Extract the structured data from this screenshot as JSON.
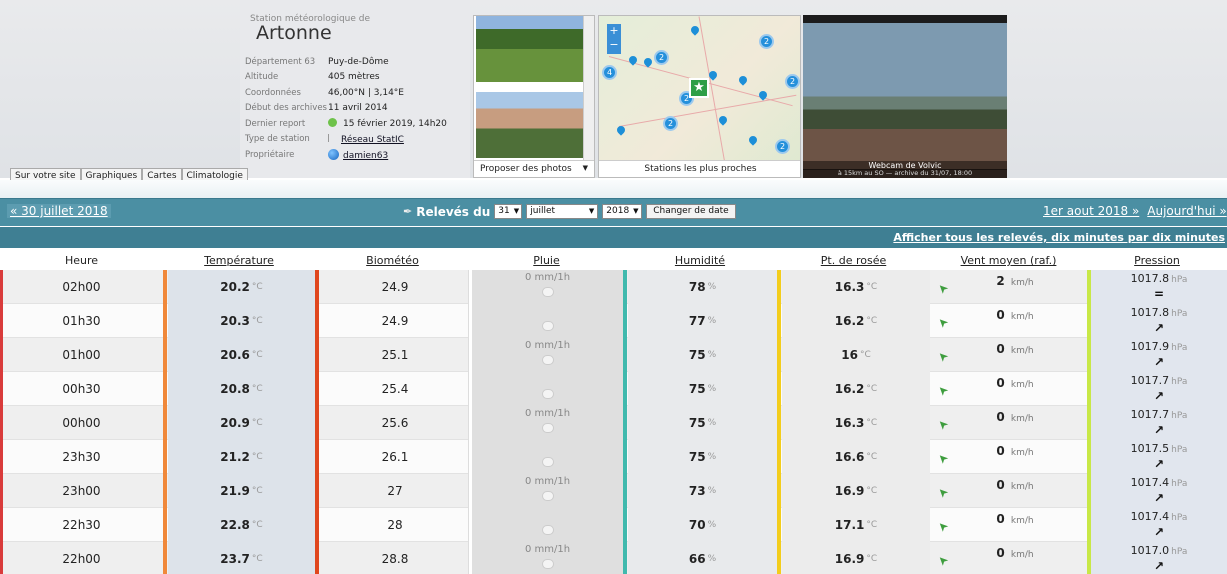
{
  "header": {
    "station_subtitle": "Station météorologique de",
    "station_name": "Artonne",
    "info": [
      {
        "label": "Département 63",
        "value": "Puy-de-Dôme"
      },
      {
        "label": "Altitude",
        "value": "405 mètres"
      },
      {
        "label": "Coordonnées",
        "value": "46,00°N | 3,14°E"
      },
      {
        "label": "Début des archives",
        "value": "11 avril 2014"
      },
      {
        "label": "Dernier report",
        "value": "15 février 2019, 14h20"
      },
      {
        "label": "Type de station",
        "value": "Réseau StatIC"
      },
      {
        "label": "Propriétaire",
        "value": "damien63"
      }
    ],
    "tabs": [
      "Sur votre site",
      "Graphiques",
      "Cartes",
      "Climatologie"
    ],
    "photos_footer": "Proposer des photos",
    "map_footer": "Stations les plus proches",
    "map_clusters": [
      "2",
      "2",
      "4",
      "2",
      "2",
      "2",
      "2"
    ],
    "map_zoom": {
      "plus": "+",
      "minus": "−"
    },
    "webcam_label": "Webcam de Volvic",
    "webcam_sub": "à 15km au SO — archive du 31/07, 18:00"
  },
  "nav": {
    "prev": "« 30 juillet 2018",
    "releves_label": "Relevés du",
    "day": "31",
    "month": "juillet",
    "year": "2018",
    "change_button": "Changer de date",
    "next": "1er aout 2018 »",
    "today": "Aujourd'hui »",
    "show_all": "Afficher tous les relevés, dix minutes par dix minutes"
  },
  "table": {
    "columns": [
      "Heure",
      "Température",
      "Biométéo",
      "Pluie",
      "Humidité",
      "Pt. de rosée",
      "Vent moyen (raf.)",
      "Pression"
    ],
    "units": {
      "temp": "°C",
      "rain": "mm/1h",
      "hum": "%",
      "wind": "km/h",
      "press": "hPa"
    },
    "rows": [
      {
        "time": "02h00",
        "temp": "20.2",
        "bio": "24.9",
        "rain": "0",
        "hum": "78",
        "dew": "16.3",
        "wind": "2",
        "press": "1017.8",
        "trend": "="
      },
      {
        "time": "01h30",
        "temp": "20.3",
        "bio": "24.9",
        "rain": "",
        "hum": "77",
        "dew": "16.2",
        "wind": "0",
        "press": "1017.8",
        "trend": "↗"
      },
      {
        "time": "01h00",
        "temp": "20.6",
        "bio": "25.1",
        "rain": "0",
        "hum": "75",
        "dew": "16",
        "wind": "0",
        "press": "1017.9",
        "trend": "↗"
      },
      {
        "time": "00h30",
        "temp": "20.8",
        "bio": "25.4",
        "rain": "",
        "hum": "75",
        "dew": "16.2",
        "wind": "0",
        "press": "1017.7",
        "trend": "↗"
      },
      {
        "time": "00h00",
        "temp": "20.9",
        "bio": "25.6",
        "rain": "0",
        "hum": "75",
        "dew": "16.3",
        "wind": "0",
        "press": "1017.7",
        "trend": "↗"
      },
      {
        "time": "23h30",
        "temp": "21.2",
        "bio": "26.1",
        "rain": "",
        "hum": "75",
        "dew": "16.6",
        "wind": "0",
        "press": "1017.5",
        "trend": "↗"
      },
      {
        "time": "23h00",
        "temp": "21.9",
        "bio": "27",
        "rain": "0",
        "hum": "73",
        "dew": "16.9",
        "wind": "0",
        "press": "1017.4",
        "trend": "↗"
      },
      {
        "time": "22h30",
        "temp": "22.8",
        "bio": "28",
        "rain": "",
        "hum": "70",
        "dew": "17.1",
        "wind": "0",
        "press": "1017.4",
        "trend": "↗"
      },
      {
        "time": "22h00",
        "temp": "23.7",
        "bio": "28.8",
        "rain": "0",
        "hum": "66",
        "dew": "16.9",
        "wind": "0",
        "press": "1017.0",
        "trend": "↗"
      }
    ]
  },
  "colors": {
    "nav_bg": "#4b8fa3",
    "temp_bar": "#f0883a",
    "bio_bar": "#e0471e",
    "rain_bar": "#ffffff",
    "hum_bar": "#40b9ad",
    "dew_bar": "#f3cd1c",
    "press_bar": "#c8e847",
    "time_bar": "#d93b3b"
  }
}
